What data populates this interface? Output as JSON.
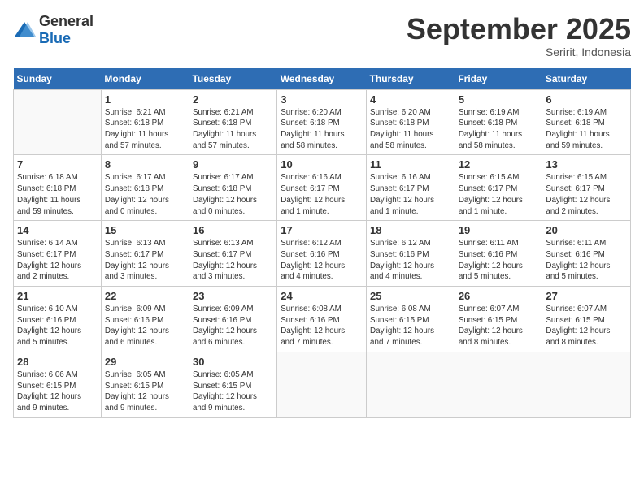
{
  "logo": {
    "general": "General",
    "blue": "Blue"
  },
  "title": "September 2025",
  "subtitle": "Seririt, Indonesia",
  "days_of_week": [
    "Sunday",
    "Monday",
    "Tuesday",
    "Wednesday",
    "Thursday",
    "Friday",
    "Saturday"
  ],
  "weeks": [
    [
      {
        "day": "",
        "info": ""
      },
      {
        "day": "1",
        "info": "Sunrise: 6:21 AM\nSunset: 6:18 PM\nDaylight: 11 hours\nand 57 minutes."
      },
      {
        "day": "2",
        "info": "Sunrise: 6:21 AM\nSunset: 6:18 PM\nDaylight: 11 hours\nand 57 minutes."
      },
      {
        "day": "3",
        "info": "Sunrise: 6:20 AM\nSunset: 6:18 PM\nDaylight: 11 hours\nand 58 minutes."
      },
      {
        "day": "4",
        "info": "Sunrise: 6:20 AM\nSunset: 6:18 PM\nDaylight: 11 hours\nand 58 minutes."
      },
      {
        "day": "5",
        "info": "Sunrise: 6:19 AM\nSunset: 6:18 PM\nDaylight: 11 hours\nand 58 minutes."
      },
      {
        "day": "6",
        "info": "Sunrise: 6:19 AM\nSunset: 6:18 PM\nDaylight: 11 hours\nand 59 minutes."
      }
    ],
    [
      {
        "day": "7",
        "info": "Sunrise: 6:18 AM\nSunset: 6:18 PM\nDaylight: 11 hours\nand 59 minutes."
      },
      {
        "day": "8",
        "info": "Sunrise: 6:17 AM\nSunset: 6:18 PM\nDaylight: 12 hours\nand 0 minutes."
      },
      {
        "day": "9",
        "info": "Sunrise: 6:17 AM\nSunset: 6:18 PM\nDaylight: 12 hours\nand 0 minutes."
      },
      {
        "day": "10",
        "info": "Sunrise: 6:16 AM\nSunset: 6:17 PM\nDaylight: 12 hours\nand 1 minute."
      },
      {
        "day": "11",
        "info": "Sunrise: 6:16 AM\nSunset: 6:17 PM\nDaylight: 12 hours\nand 1 minute."
      },
      {
        "day": "12",
        "info": "Sunrise: 6:15 AM\nSunset: 6:17 PM\nDaylight: 12 hours\nand 1 minute."
      },
      {
        "day": "13",
        "info": "Sunrise: 6:15 AM\nSunset: 6:17 PM\nDaylight: 12 hours\nand 2 minutes."
      }
    ],
    [
      {
        "day": "14",
        "info": "Sunrise: 6:14 AM\nSunset: 6:17 PM\nDaylight: 12 hours\nand 2 minutes."
      },
      {
        "day": "15",
        "info": "Sunrise: 6:13 AM\nSunset: 6:17 PM\nDaylight: 12 hours\nand 3 minutes."
      },
      {
        "day": "16",
        "info": "Sunrise: 6:13 AM\nSunset: 6:17 PM\nDaylight: 12 hours\nand 3 minutes."
      },
      {
        "day": "17",
        "info": "Sunrise: 6:12 AM\nSunset: 6:16 PM\nDaylight: 12 hours\nand 4 minutes."
      },
      {
        "day": "18",
        "info": "Sunrise: 6:12 AM\nSunset: 6:16 PM\nDaylight: 12 hours\nand 4 minutes."
      },
      {
        "day": "19",
        "info": "Sunrise: 6:11 AM\nSunset: 6:16 PM\nDaylight: 12 hours\nand 5 minutes."
      },
      {
        "day": "20",
        "info": "Sunrise: 6:11 AM\nSunset: 6:16 PM\nDaylight: 12 hours\nand 5 minutes."
      }
    ],
    [
      {
        "day": "21",
        "info": "Sunrise: 6:10 AM\nSunset: 6:16 PM\nDaylight: 12 hours\nand 5 minutes."
      },
      {
        "day": "22",
        "info": "Sunrise: 6:09 AM\nSunset: 6:16 PM\nDaylight: 12 hours\nand 6 minutes."
      },
      {
        "day": "23",
        "info": "Sunrise: 6:09 AM\nSunset: 6:16 PM\nDaylight: 12 hours\nand 6 minutes."
      },
      {
        "day": "24",
        "info": "Sunrise: 6:08 AM\nSunset: 6:16 PM\nDaylight: 12 hours\nand 7 minutes."
      },
      {
        "day": "25",
        "info": "Sunrise: 6:08 AM\nSunset: 6:15 PM\nDaylight: 12 hours\nand 7 minutes."
      },
      {
        "day": "26",
        "info": "Sunrise: 6:07 AM\nSunset: 6:15 PM\nDaylight: 12 hours\nand 8 minutes."
      },
      {
        "day": "27",
        "info": "Sunrise: 6:07 AM\nSunset: 6:15 PM\nDaylight: 12 hours\nand 8 minutes."
      }
    ],
    [
      {
        "day": "28",
        "info": "Sunrise: 6:06 AM\nSunset: 6:15 PM\nDaylight: 12 hours\nand 9 minutes."
      },
      {
        "day": "29",
        "info": "Sunrise: 6:05 AM\nSunset: 6:15 PM\nDaylight: 12 hours\nand 9 minutes."
      },
      {
        "day": "30",
        "info": "Sunrise: 6:05 AM\nSunset: 6:15 PM\nDaylight: 12 hours\nand 9 minutes."
      },
      {
        "day": "",
        "info": ""
      },
      {
        "day": "",
        "info": ""
      },
      {
        "day": "",
        "info": ""
      },
      {
        "day": "",
        "info": ""
      }
    ]
  ]
}
